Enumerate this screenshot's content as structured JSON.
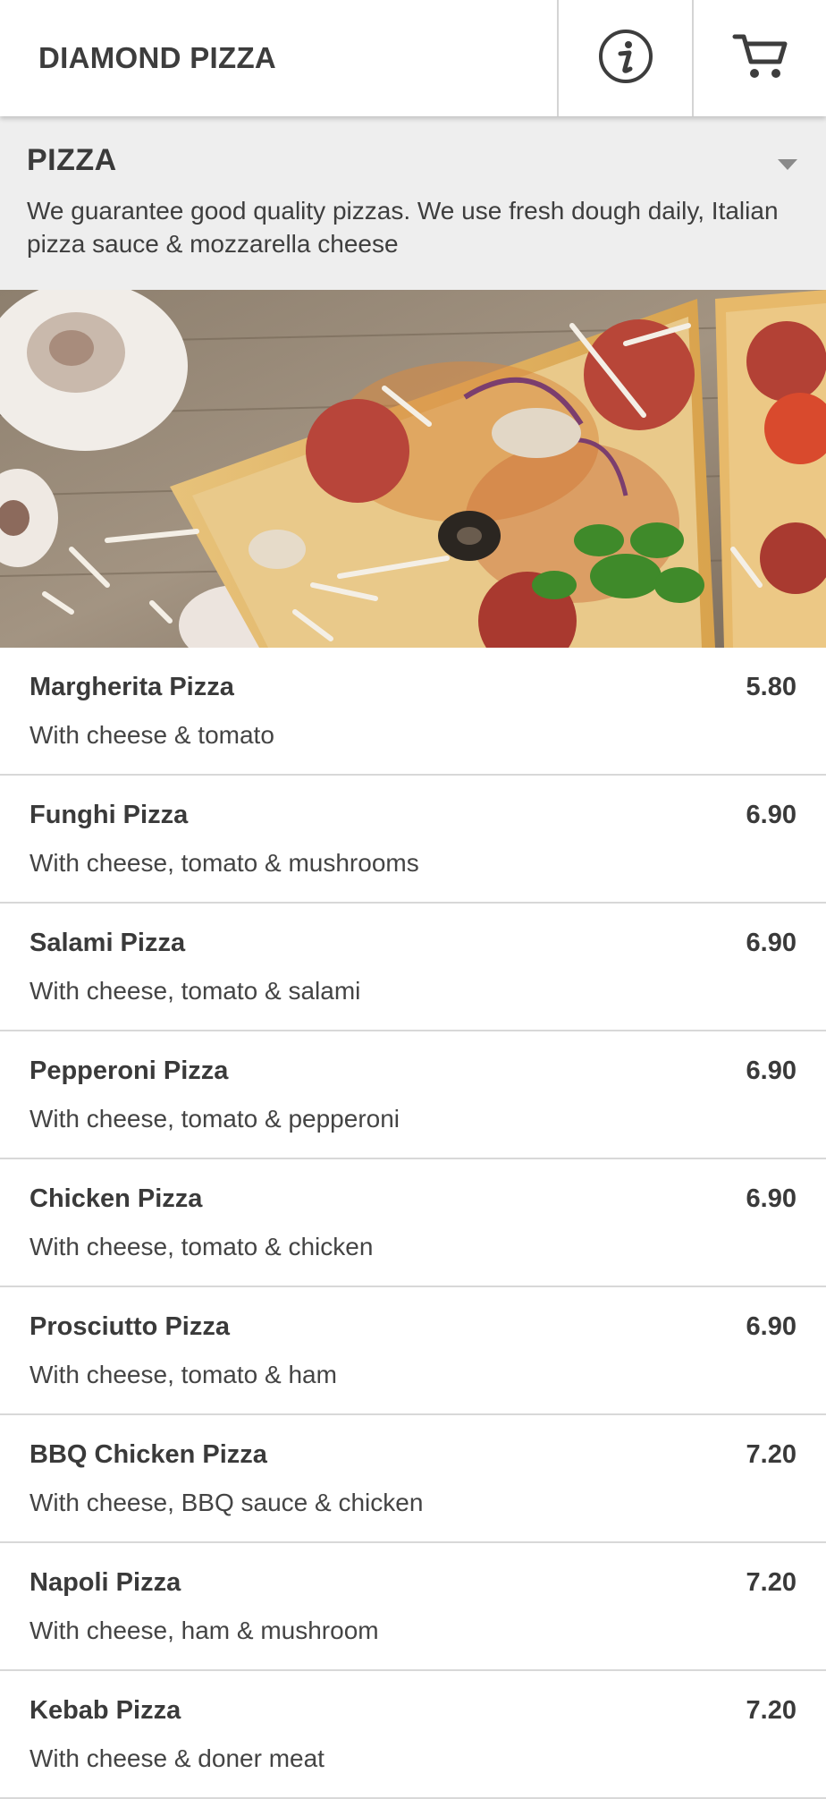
{
  "header": {
    "brand": "DIAMOND PIZZA",
    "info_icon": "info-icon",
    "cart_icon": "cart-icon"
  },
  "category": {
    "title": "PIZZA",
    "description": "We guarantee good quality pizzas. We use fresh dough daily, Italian pizza sauce & mozzarella cheese"
  },
  "menu": {
    "items": [
      {
        "name": "Margherita Pizza",
        "price": "5.80",
        "description": "With cheese & tomato"
      },
      {
        "name": "Funghi Pizza",
        "price": "6.90",
        "description": "With cheese, tomato & mushrooms"
      },
      {
        "name": "Salami Pizza",
        "price": "6.90",
        "description": "With cheese, tomato & salami"
      },
      {
        "name": "Pepperoni Pizza",
        "price": "6.90",
        "description": "With cheese, tomato & pepperoni"
      },
      {
        "name": "Chicken Pizza",
        "price": "6.90",
        "description": "With cheese, tomato & chicken"
      },
      {
        "name": "Prosciutto Pizza",
        "price": "6.90",
        "description": "With cheese, tomato & ham"
      },
      {
        "name": "BBQ Chicken Pizza",
        "price": "7.20",
        "description": "With cheese, BBQ sauce & chicken"
      },
      {
        "name": "Napoli Pizza",
        "price": "7.20",
        "description": "With cheese, ham & mushroom"
      },
      {
        "name": "Kebab Pizza",
        "price": "7.20",
        "description": "With cheese & doner meat"
      }
    ]
  },
  "colors": {
    "header_bg": "#ffffff",
    "category_bg": "#eeeeee",
    "text": "#3a3a3a",
    "divider": "#d8d8d8"
  }
}
